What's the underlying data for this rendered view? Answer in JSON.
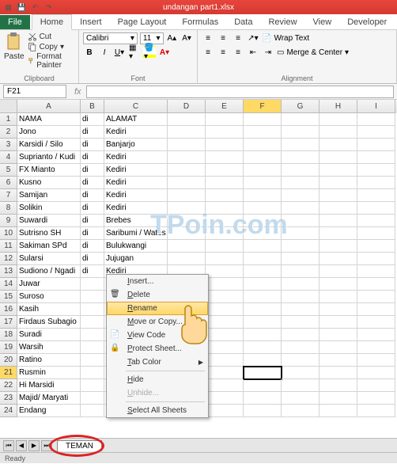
{
  "title": "undangan part1.xlsx",
  "tabs": {
    "file": "File",
    "list": [
      "Home",
      "Insert",
      "Page Layout",
      "Formulas",
      "Data",
      "Review",
      "View",
      "Developer"
    ],
    "active": "Home"
  },
  "ribbon": {
    "clipboard": {
      "paste": "Paste",
      "cut": "Cut",
      "copy": "Copy",
      "painter": "Format Painter",
      "label": "Clipboard"
    },
    "font": {
      "name": "Calibri",
      "size": "11",
      "label": "Font"
    },
    "align": {
      "wrap": "Wrap Text",
      "merge": "Merge & Center",
      "label": "Alignment"
    }
  },
  "namebox": "F21",
  "columns": [
    "A",
    "B",
    "C",
    "D",
    "E",
    "F",
    "G",
    "H",
    "I"
  ],
  "col_widths": [
    "wA",
    "wB",
    "wC",
    "wD",
    "wE",
    "wF",
    "wG",
    "wH",
    "wI"
  ],
  "active_col": "F",
  "active_row": 21,
  "rows": [
    {
      "n": 1,
      "A": "NAMA",
      "B": "di",
      "C": "ALAMAT"
    },
    {
      "n": 2,
      "A": "Jono",
      "B": "di",
      "C": "Kediri"
    },
    {
      "n": 3,
      "A": "Karsidi / Silo",
      "B": "di",
      "C": "Banjarjo"
    },
    {
      "n": 4,
      "A": "Suprianto / Kudi",
      "B": "di",
      "C": "Kediri"
    },
    {
      "n": 5,
      "A": "FX Mianto",
      "B": "di",
      "C": "Kediri"
    },
    {
      "n": 6,
      "A": "Kusno",
      "B": "di",
      "C": "Kediri"
    },
    {
      "n": 7,
      "A": "Samijan",
      "B": "di",
      "C": "Kediri"
    },
    {
      "n": 8,
      "A": "Solikin",
      "B": "di",
      "C": "Kediri"
    },
    {
      "n": 9,
      "A": "Suwardi",
      "B": "di",
      "C": "Brebes"
    },
    {
      "n": 10,
      "A": "Sutrisno SH",
      "B": "di",
      "C": "Saribumi / Wates"
    },
    {
      "n": 11,
      "A": "Sakiman SPd",
      "B": "di",
      "C": "Bulukwangi"
    },
    {
      "n": 12,
      "A": "Sularsi",
      "B": "di",
      "C": "Jujugan"
    },
    {
      "n": 13,
      "A": "Sudiono / Ngadi",
      "B": "di",
      "C": "Kediri"
    },
    {
      "n": 14,
      "A": "Juwar"
    },
    {
      "n": 15,
      "A": "Suroso"
    },
    {
      "n": 16,
      "A": "Kasih"
    },
    {
      "n": 17,
      "A": "Firdaus Subagio"
    },
    {
      "n": 18,
      "A": "Suradi"
    },
    {
      "n": 19,
      "A": "Warsih"
    },
    {
      "n": 20,
      "A": "Ratino"
    },
    {
      "n": 21,
      "A": "Rusmin"
    },
    {
      "n": 22,
      "A": "Hi Marsidi"
    },
    {
      "n": 23,
      "A": "Majid/ Maryati"
    },
    {
      "n": 24,
      "A": "Endang"
    }
  ],
  "sheet_tab": "TEMAN",
  "context_menu": [
    {
      "label": "Insert...",
      "icon": ""
    },
    {
      "label": "Delete",
      "icon": "del"
    },
    {
      "label": "Rename",
      "hover": true
    },
    {
      "label": "Move or Copy..."
    },
    {
      "label": "View Code",
      "icon": "code"
    },
    {
      "label": "Protect Sheet...",
      "icon": "lock"
    },
    {
      "label": "Tab Color",
      "arrow": true
    },
    {
      "sep": true
    },
    {
      "label": "Hide"
    },
    {
      "label": "Unhide...",
      "disabled": true
    },
    {
      "sep": true
    },
    {
      "label": "Select All Sheets"
    }
  ],
  "status": "Ready",
  "watermark": "TPoin.com"
}
